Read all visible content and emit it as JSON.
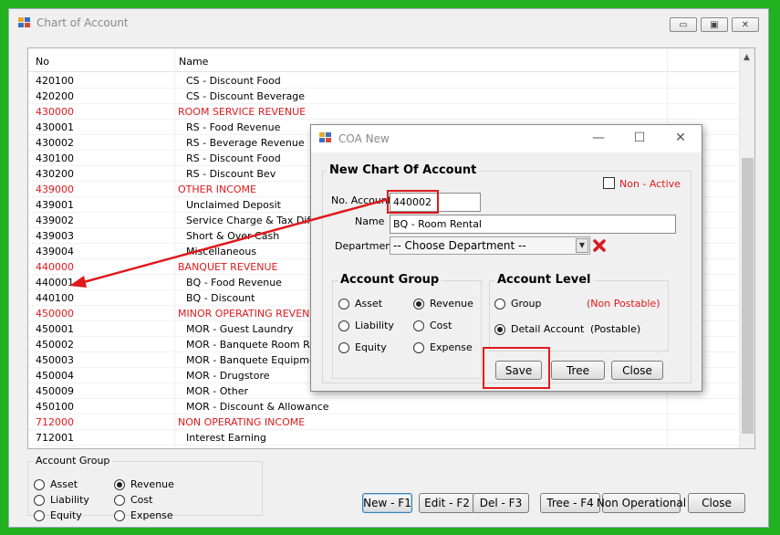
{
  "main_window": {
    "title": "Chart of Account",
    "grid": {
      "headers": [
        "No",
        "Name"
      ],
      "rows": [
        {
          "no": "420100",
          "name": "CS - Discount Food",
          "group": false
        },
        {
          "no": "420200",
          "name": "CS - Discount Beverage",
          "group": false
        },
        {
          "no": "430000",
          "name": "ROOM SERVICE REVENUE",
          "group": true
        },
        {
          "no": "430001",
          "name": "RS - Food Revenue",
          "group": false
        },
        {
          "no": "430002",
          "name": "RS - Beverage Revenue",
          "group": false
        },
        {
          "no": "430100",
          "name": "RS - Discount Food",
          "group": false
        },
        {
          "no": "430200",
          "name": "RS - Discount Bev",
          "group": false
        },
        {
          "no": "439000",
          "name": "OTHER INCOME",
          "group": true
        },
        {
          "no": "439001",
          "name": "Unclaimed Deposit",
          "group": false
        },
        {
          "no": "439002",
          "name": "Service Charge & Tax Differe",
          "group": false
        },
        {
          "no": "439003",
          "name": "Short & Over Cash",
          "group": false
        },
        {
          "no": "439004",
          "name": "Miscellaneous",
          "group": false
        },
        {
          "no": "440000",
          "name": "BANQUET REVENUE",
          "group": true
        },
        {
          "no": "440001",
          "name": "BQ - Food Revenue",
          "group": false
        },
        {
          "no": "440100",
          "name": "BQ - Discount",
          "group": false
        },
        {
          "no": "450000",
          "name": "MINOR OPERATING REVENUE",
          "group": true
        },
        {
          "no": "450001",
          "name": "MOR - Guest Laundry",
          "group": false
        },
        {
          "no": "450002",
          "name": "MOR - Banquete Room Renta",
          "group": false
        },
        {
          "no": "450003",
          "name": "MOR - Banquete Equipment R",
          "group": false
        },
        {
          "no": "450004",
          "name": "MOR - Drugstore",
          "group": false
        },
        {
          "no": "450009",
          "name": "MOR - Other",
          "group": false
        },
        {
          "no": "450100",
          "name": "MOR - Discount & Allowance",
          "group": false
        },
        {
          "no": "712000",
          "name": "NON OPERATING INCOME",
          "group": true
        },
        {
          "no": "712001",
          "name": "Interest Earning",
          "group": false
        }
      ]
    },
    "account_group": {
      "title": "Account Group",
      "options": [
        "Asset",
        "Revenue",
        "Liability",
        "Cost",
        "Equity",
        "Expense"
      ],
      "selected": "Revenue"
    },
    "buttons": {
      "new": "New - F1",
      "edit": "Edit - F2",
      "del": "Del - F3",
      "tree": "Tree - F4",
      "non_operational": "Non Operational",
      "close": "Close"
    }
  },
  "dialog": {
    "title": "COA New",
    "heading": "New Chart Of Account",
    "non_active_label": "Non - Active",
    "non_active_checked": false,
    "no_account_label": "No. Account",
    "no_account_value": "440002",
    "name_label": "Name",
    "name_value": "BQ - Room Rental",
    "department_label": "Department",
    "department_value": "-- Choose Department --",
    "account_group": {
      "title": "Account Group",
      "options": [
        "Asset",
        "Revenue",
        "Liability",
        "Cost",
        "Equity",
        "Expense"
      ],
      "selected": "Revenue"
    },
    "account_level": {
      "title": "Account Level",
      "group_label": "Group",
      "group_note": "(Non Postable)",
      "detail_label": "Detail Account",
      "detail_note": "(Postable)",
      "selected": "Detail Account"
    },
    "buttons": {
      "save": "Save",
      "tree": "Tree",
      "close": "Close"
    }
  },
  "colors": {
    "desktop": "#22b11f",
    "group_row_text": "#e0191c",
    "annotation": "#e0191c"
  }
}
